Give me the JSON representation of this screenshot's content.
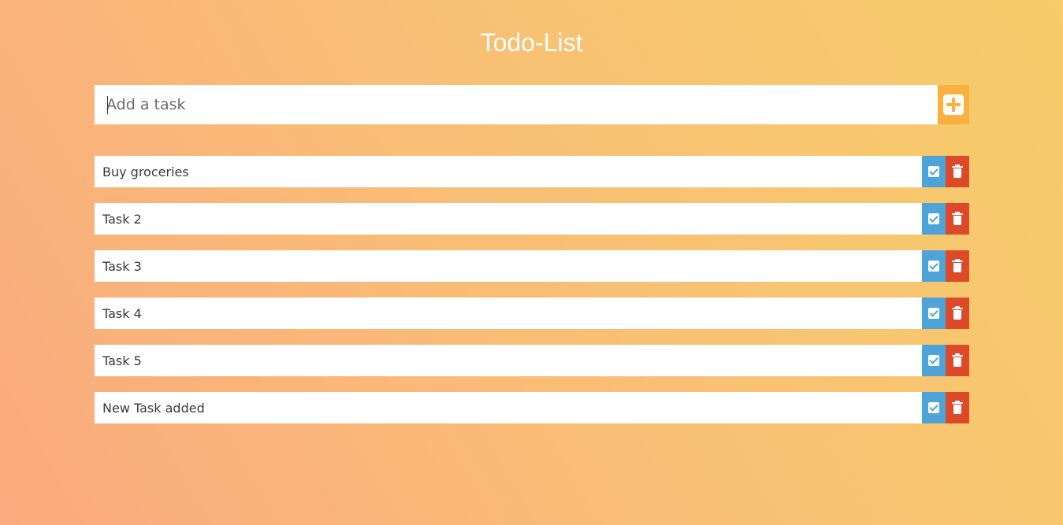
{
  "app": {
    "title": "Todo-List"
  },
  "add_task": {
    "placeholder": "Add a task",
    "value": "",
    "add_icon": "plus-square-icon"
  },
  "tasks": [
    {
      "label": "Buy groceries"
    },
    {
      "label": "Task 2"
    },
    {
      "label": "Task 3"
    },
    {
      "label": "Task 4"
    },
    {
      "label": "Task 5"
    },
    {
      "label": "New Task added"
    }
  ],
  "actions": {
    "complete_icon": "check-square-icon",
    "delete_icon": "trash-icon"
  },
  "colors": {
    "add_button": "#fbb040",
    "complete_button": "#4ea3d8",
    "delete_button": "#dc4a2a",
    "gradient_start": "#fbaa7f",
    "gradient_end": "#f6cd6a"
  }
}
